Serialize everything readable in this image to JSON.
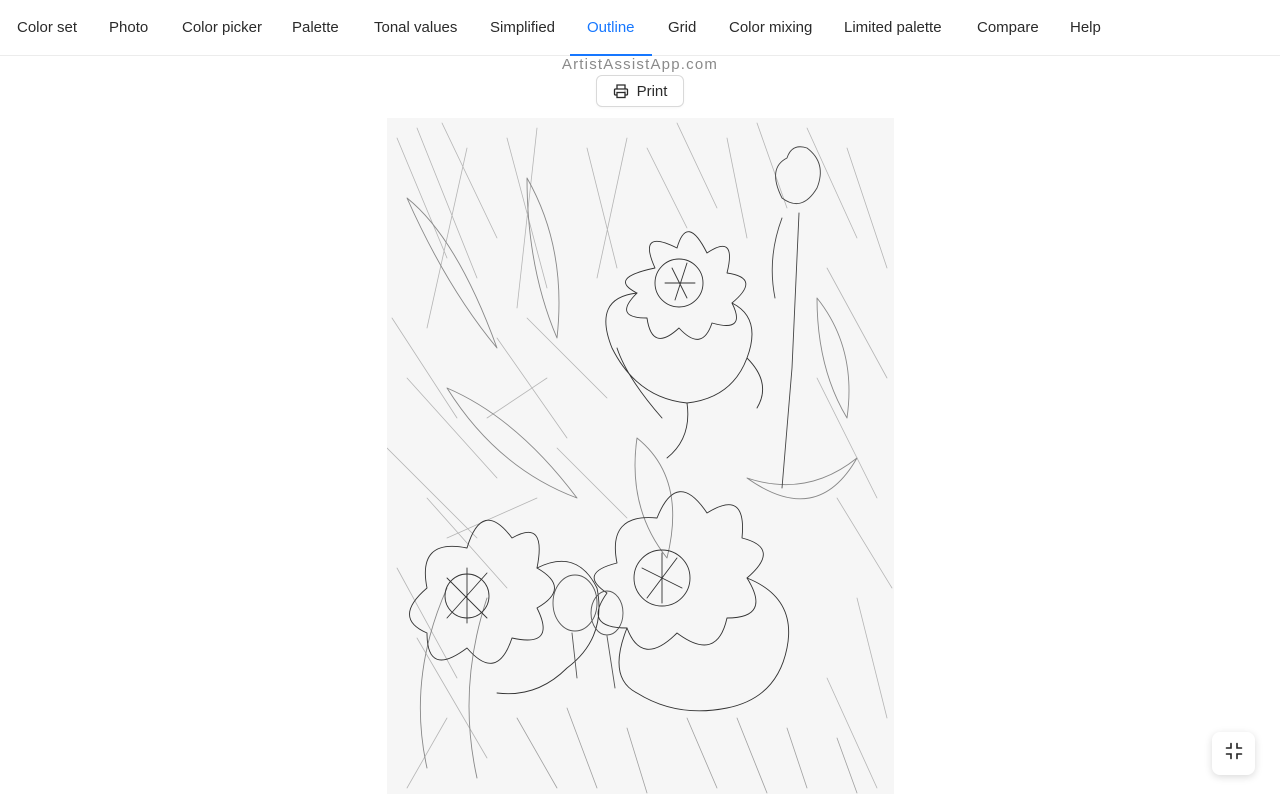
{
  "tabs": [
    {
      "label": "Color set"
    },
    {
      "label": "Photo"
    },
    {
      "label": "Color picker"
    },
    {
      "label": "Palette"
    },
    {
      "label": "Tonal values"
    },
    {
      "label": "Simplified"
    },
    {
      "label": "Outline",
      "active": true
    },
    {
      "label": "Grid"
    },
    {
      "label": "Color mixing"
    },
    {
      "label": "Limited palette"
    },
    {
      "label": "Compare"
    },
    {
      "label": "Help"
    }
  ],
  "watermark": "ArtistAssistApp.com",
  "print_button": {
    "label": "Print",
    "icon": "printer-icon"
  },
  "image": {
    "description_icon": "outline-sketch-image"
  },
  "fullscreen_button": {
    "icon": "exit-fullscreen-icon"
  },
  "colors": {
    "accent": "#1677ff",
    "text": "#2a2a2a",
    "watermark": "#8a8a8a",
    "border": "#d9d9d9"
  }
}
